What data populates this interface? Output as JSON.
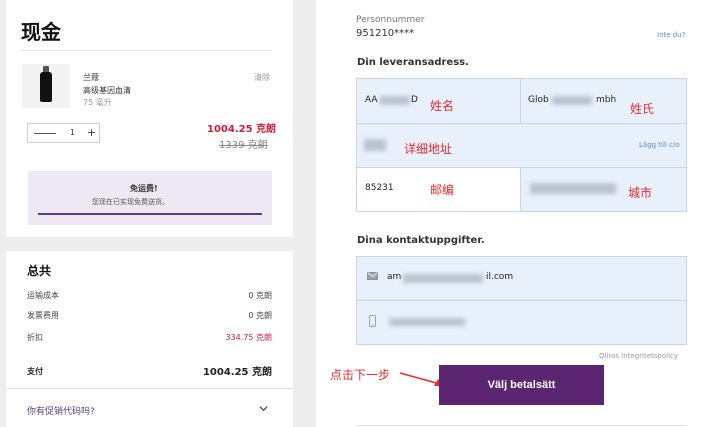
{
  "cart": {
    "title": "现金",
    "product": {
      "name": "兰蔻",
      "subtitle": "高级基因血清",
      "size": "75 毫升",
      "remove_label": "清除",
      "quantity": "1",
      "minus": "—",
      "plus": "+",
      "price_new": "1004.25 克朗",
      "price_old": "1339 克朗"
    },
    "shipping_banner": {
      "title": "免运费!",
      "subtitle": "您现在已实现免费送货。",
      "progress": 1.0
    },
    "totals": {
      "heading": "总共",
      "rows": [
        {
          "label": "运输成本",
          "value": "0 克朗"
        },
        {
          "label": "发票费用",
          "value": "0 克朗"
        },
        {
          "label": "折扣",
          "value": "334.75 克朗"
        }
      ],
      "pay_label": "支付",
      "pay_value": "1004.25 克朗"
    },
    "promo_label": "你有促销代码吗?",
    "colors": {
      "discount": "#c81e3c",
      "accent": "#5d3b86"
    }
  },
  "form": {
    "personnummer_label": "Personnummer",
    "personnummer_value": "951210****",
    "not_you": "Inte du?",
    "delivery_heading": "Din leveransadress.",
    "first_name": "AA",
    "first_name_tail": "D",
    "last_name": "Glob",
    "last_name_tail": "mbh",
    "add_co": "Lägg till c/o",
    "postal_code": "85231",
    "contact_heading": "Dina kontaktuppgifter.",
    "email_start": "am",
    "email_end": "il.com",
    "privacy": "Qliros integritetspolicy",
    "submit": "Välj betalsätt"
  },
  "annotations": {
    "first_name": "姓名",
    "last_name": "姓氏",
    "address": "详细地址",
    "postal": "邮编",
    "city": "城市",
    "hint": "点击下一步"
  }
}
